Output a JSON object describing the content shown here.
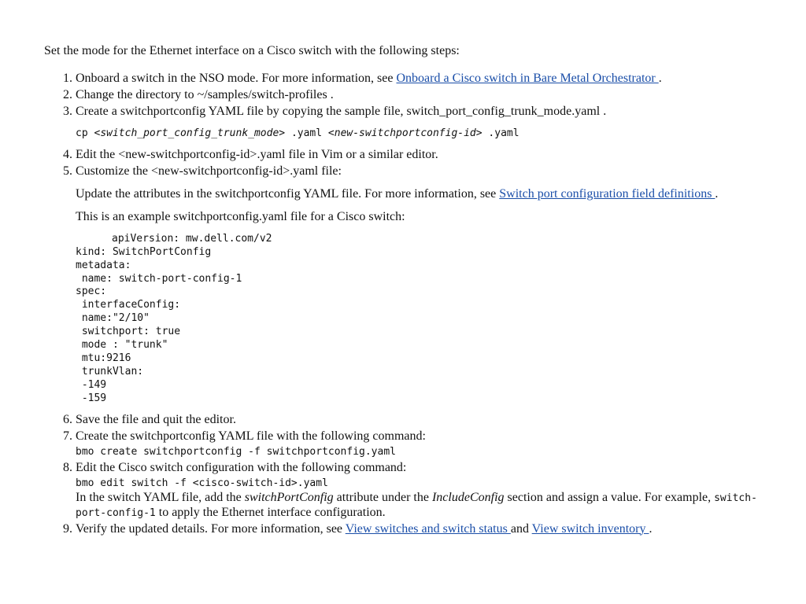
{
  "intro_text": "Set the mode for the Ethernet interface on a Cisco switch with the following steps:",
  "step1": {
    "text_a": "Onboard a switch in the NSO mode. For more information, see ",
    "link": "Onboard a Cisco switch in Bare Metal Orchestrator ",
    "text_b": "."
  },
  "step2": {
    "text_a": "Change the directory to ",
    "path": "~/samples/switch-profiles ",
    "text_b": "."
  },
  "step3": {
    "text_a": "Create a switchportconfig YAML file by copying the sample file, ",
    "file": "switch_port_config_trunk_mode.yaml ",
    "text_b": ".",
    "code": {
      "cp": "cp ",
      "lt1": "<",
      "var1": "switch_port_config_trunk_mode",
      "gt1": ">",
      "mid": " .yaml ",
      "lt2": "<",
      "var2": "new-switchportconfig-id",
      "gt2": ">",
      "end": " .yaml"
    }
  },
  "step4": {
    "text_a": "Edit the ",
    "file": "<new-switchportconfig-id>.yaml",
    "text_b": " file in Vim or a similar editor."
  },
  "step5": {
    "text_a": "Customize the ",
    "file": "<new-switchportconfig-id>.yaml",
    "text_b": " file:",
    "para1_a": "Update the attributes in the switchportconfig YAML file. For more information, see ",
    "link1": "Switch port configuration field definitions ",
    "para1_b": ".",
    "para2": "This is an example switchportconfig.yaml file for a Cisco switch:",
    "yaml_line1": "apiVersion: mw.dell.com/v2",
    "yaml_rest": "kind: SwitchPortConfig\nmetadata:\n name: switch-port-config-1\nspec:\n interfaceConfig:\n name:\"2/10\"\n switchport: true\n mode : \"trunk\"\n mtu:9216\n trunkVlan:\n -149\n -159"
  },
  "step6": "Save the file and quit the editor.",
  "step7": {
    "text": "Create the switchportconfig YAML file with the following command:",
    "code": "bmo create switchportconfig -f switchportconfig.yaml"
  },
  "step8": {
    "text": "Edit the Cisco switch configuration with the following command:",
    "code": "bmo edit switch -f <cisco-switch-id>.yaml",
    "after_a": "In the switch YAML file, add the ",
    "ital1": "switchPortConfig",
    "after_b": " attribute under the ",
    "ital2": "IncludeConfig",
    "after_c": " section and assign a value. For example, ",
    "code2": "switch-port-config-1",
    "after_d": " to apply the Ethernet interface configuration."
  },
  "step9": {
    "text_a": "Verify the updated details. For more information, see ",
    "link1": "View switches and switch status ",
    "and": "and ",
    "link2": "View switch inventory ",
    "text_b": "."
  }
}
